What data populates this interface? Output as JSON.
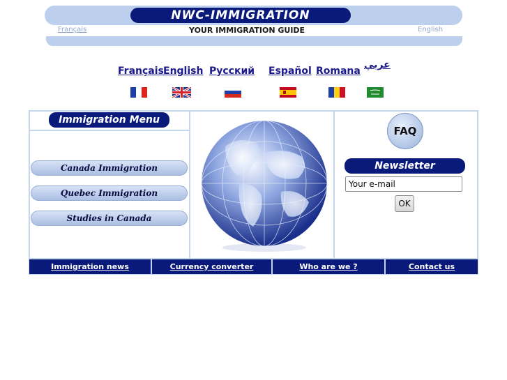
{
  "header": {
    "logo": "NWC-IMMIGRATION",
    "link_fr": "Français",
    "tagline": "YOUR IMMIGRATION GUIDE",
    "link_en": "English"
  },
  "languages": [
    {
      "label": "Français",
      "flag": "fr-flag-icon"
    },
    {
      "label": "English",
      "flag": "uk-flag-icon"
    },
    {
      "label": "Русский",
      "flag": "ru-flag-icon"
    },
    {
      "label": "Español",
      "flag": "es-flag-icon"
    },
    {
      "label": "Romana",
      "flag": "ro-flag-icon"
    },
    {
      "label": "عربي",
      "flag": "sa-flag-icon"
    }
  ],
  "menu": {
    "title": "Immigration Menu",
    "items": [
      "Canada Immigration",
      "Quebec Immigration",
      "Studies in Canada"
    ]
  },
  "right_panel": {
    "faq": "FAQ",
    "newsletter_title": "Newsletter",
    "email_value": "Your e-mail",
    "ok_label": "OK"
  },
  "nav": [
    "Immigration news",
    "Currency converter",
    "Who are we ?",
    "Contact us"
  ],
  "colors": {
    "navy": "#0a1a7a",
    "banner": "#bcd0ee",
    "border": "#c4d6ee",
    "link": "#1a1a8c"
  }
}
